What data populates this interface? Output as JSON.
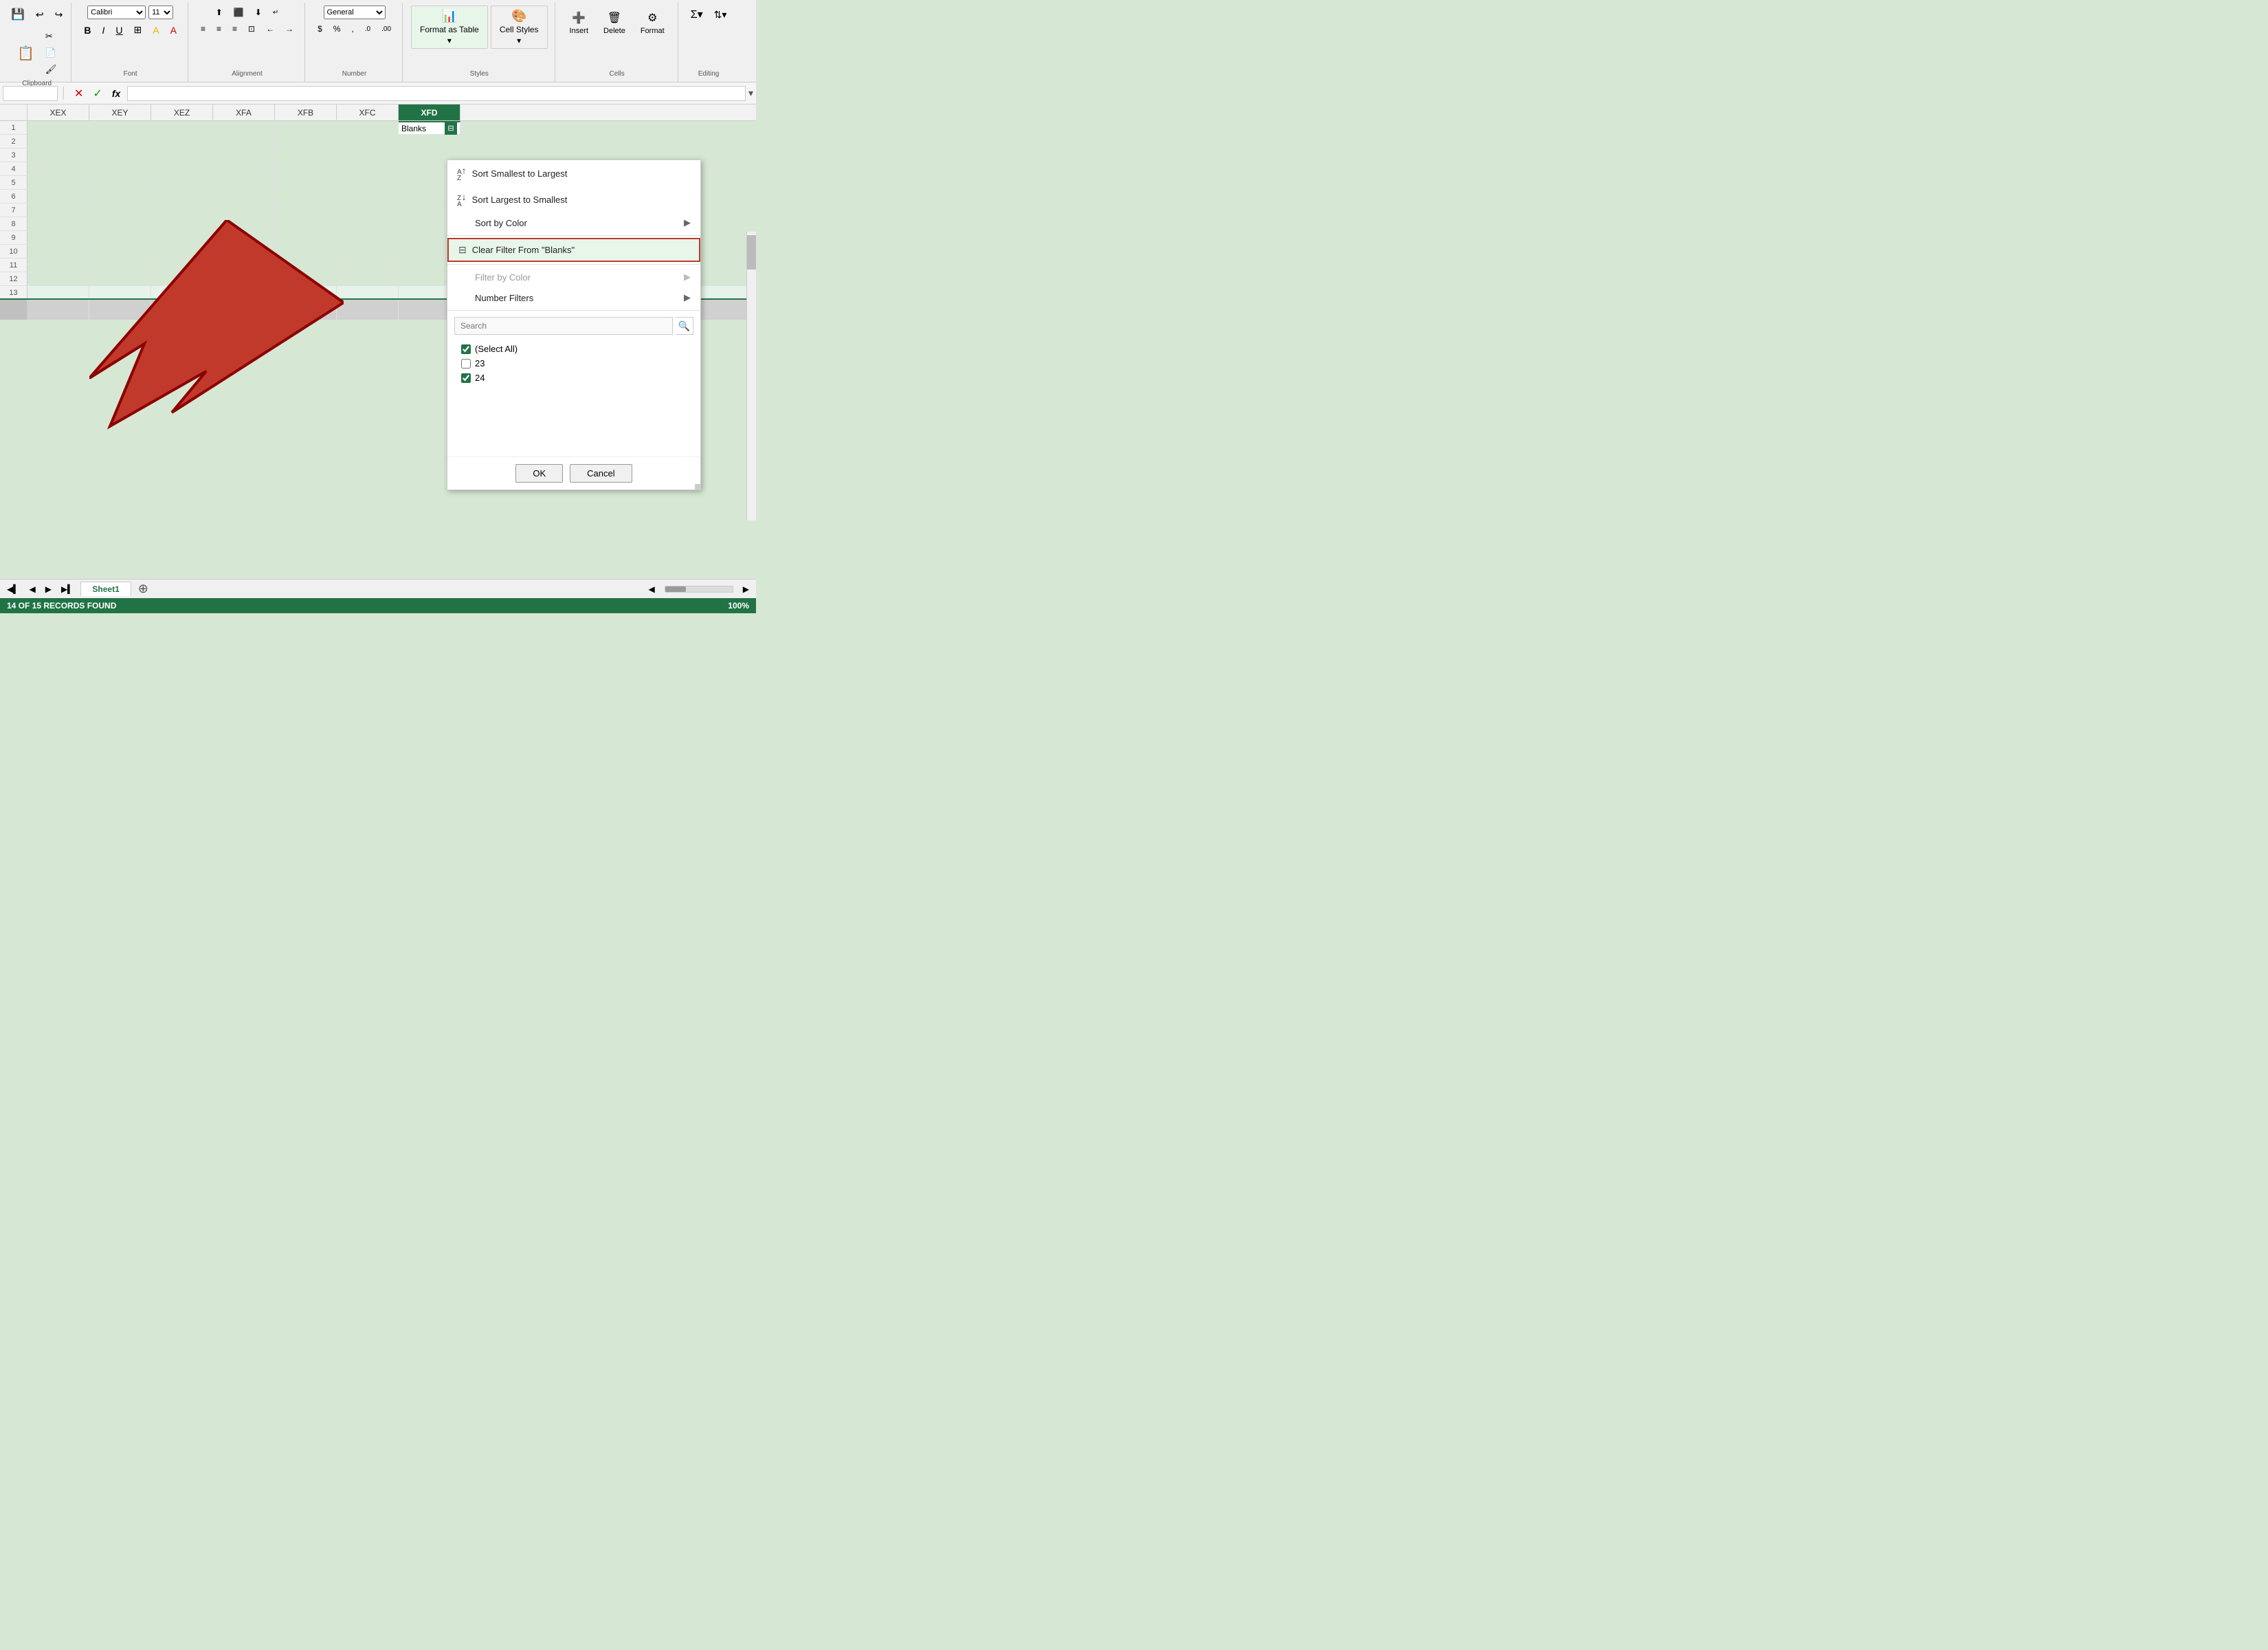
{
  "ribbon": {
    "sections": {
      "font": {
        "label": "Font",
        "buttons": [
          "B",
          "I",
          "U",
          "A",
          "A"
        ]
      },
      "alignment": {
        "label": "Alignment",
        "buttons": [
          "≡",
          "≡",
          "≡",
          "⊞",
          "←",
          "→",
          "↕"
        ]
      },
      "number": {
        "label": "Number",
        "buttons": [
          "$",
          "%",
          ",",
          ".0",
          ".00"
        ]
      },
      "styles": {
        "label": "Styles",
        "format_table": "Format as Table",
        "cell_styles": "Cell Styles"
      },
      "cells": {
        "label": "Cells",
        "delete": "Delete",
        "format": "Format"
      },
      "editing": {
        "label": "Editing",
        "chevron": "▲"
      }
    }
  },
  "formula_bar": {
    "name_box_placeholder": "",
    "formula_placeholder": ""
  },
  "columns": [
    "XEX",
    "XEY",
    "XEZ",
    "XFA",
    "XFB",
    "XFC",
    "XFD"
  ],
  "xfd_cell_value": "Blanks",
  "grid_rows": 18,
  "sheet_tab": "Sheet1",
  "status_bar": "14 OF 15 RECORDS FOUND",
  "dropdown": {
    "items": [
      {
        "id": "sort-asc",
        "label": "Sort Smallest to Largest",
        "icon": "↑A",
        "has_sub": false,
        "disabled": false,
        "highlighted": false
      },
      {
        "id": "sort-desc",
        "label": "Sort Largest to Smallest",
        "icon": "↓Z",
        "has_sub": false,
        "disabled": false,
        "highlighted": false
      },
      {
        "id": "sort-color",
        "label": "Sort by Color",
        "icon": "",
        "has_sub": true,
        "disabled": false,
        "highlighted": false
      },
      {
        "id": "clear-filter",
        "label": "Clear Filter From \"Blanks\"",
        "icon": "✕",
        "has_sub": false,
        "disabled": false,
        "highlighted": true
      },
      {
        "id": "filter-color",
        "label": "Filter by Color",
        "icon": "",
        "has_sub": true,
        "disabled": true,
        "highlighted": false
      },
      {
        "id": "number-filters",
        "label": "Number Filters",
        "icon": "",
        "has_sub": true,
        "disabled": false,
        "highlighted": false
      }
    ],
    "search_placeholder": "Search",
    "checkboxes": [
      {
        "id": "select-all",
        "label": "(Select All)",
        "checked": true,
        "indeterminate": true
      },
      {
        "id": "val-23",
        "label": "23",
        "checked": false,
        "indeterminate": false
      },
      {
        "id": "val-24",
        "label": "24",
        "checked": true,
        "indeterminate": false
      }
    ],
    "ok_label": "OK",
    "cancel_label": "Cancel"
  }
}
